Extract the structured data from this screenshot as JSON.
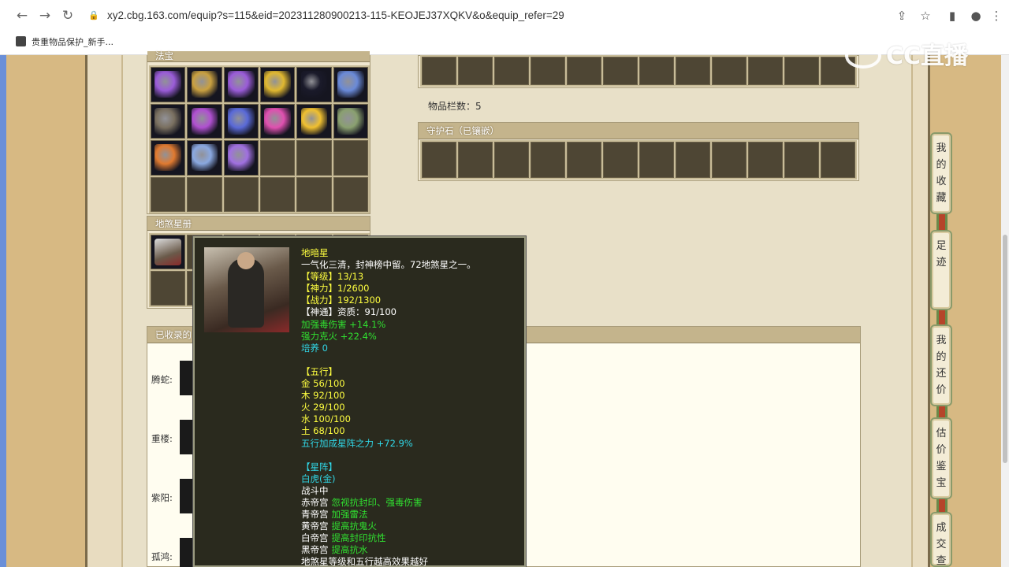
{
  "browser": {
    "url": "xy2.cbg.163.com/equip?s=115&eid=202311280900213-115-KEOJEJ37XQKV&o&equip_refer=29",
    "bookmark": "贵重物品保护_新手..."
  },
  "watermark": "CC直播",
  "fabao": {
    "title": "法宝",
    "items": [
      "purple-box",
      "gold-token",
      "violet-wand",
      "gold-pagoda",
      "dark-orb",
      "blue-glove",
      "grey-tablet",
      "purple-ribbon",
      "blue-scroll",
      "pink-lantern",
      "gold-cloud",
      "green-bell",
      "orange-shard",
      "blue-bracer",
      "purple-hammer"
    ]
  },
  "star_register": {
    "title": "地煞星册"
  },
  "slots": {
    "count_label": "物品栏数：5"
  },
  "guard_stone": {
    "title": "守护石（已镶嵌）"
  },
  "collected": {
    "title": "已收录的",
    "rows": [
      "腾蛇:",
      "重楼:",
      "紫阳:",
      "孤鸿:"
    ]
  },
  "sidebar": {
    "tabs": [
      "我的收藏",
      "足迹",
      "我的还价",
      "估价鉴宝",
      "成交查"
    ]
  },
  "tooltip": {
    "lines": [
      {
        "color": "yellow",
        "text": "地暗星"
      },
      {
        "color": "white",
        "text": "一气化三清，封神榜中留。72地煞星之一。"
      },
      {
        "color": "yellow",
        "text": "【等级】13/13"
      },
      {
        "color": "yellow",
        "text": "【神力】1/2600"
      },
      {
        "color": "yellow",
        "text": "【战力】192/1300"
      },
      {
        "color": "white",
        "text": "【神通】资质：91/100"
      },
      {
        "color": "green",
        "text": "加强毒伤害 +14.1%"
      },
      {
        "color": "green",
        "text": "强力克火 +22.4%"
      },
      {
        "color": "cyan",
        "text": "培养 0"
      },
      {
        "color": "white",
        "text": ""
      },
      {
        "color": "yellow",
        "text": "【五行】"
      },
      {
        "color": "yellow",
        "text": "金 56/100"
      },
      {
        "color": "yellow",
        "text": "木 92/100"
      },
      {
        "color": "yellow",
        "text": "火 29/100"
      },
      {
        "color": "yellow",
        "text": "水 100/100"
      },
      {
        "color": "yellow",
        "text": "土 68/100"
      },
      {
        "color": "cyan",
        "text": "五行加成星阵之力 +72.9%"
      },
      {
        "color": "white",
        "text": ""
      },
      {
        "color": "cyan",
        "text": "【星阵】"
      },
      {
        "color": "cyan",
        "text": "白虎(金)"
      },
      {
        "color": "white",
        "text": "战斗中"
      }
    ],
    "palaces": [
      {
        "name": "赤帝宫",
        "effect": "忽视抗封印、强毒伤害"
      },
      {
        "name": "青帝宫",
        "effect": "加强雷法"
      },
      {
        "name": "黄帝宫",
        "effect": "提高抗鬼火"
      },
      {
        "name": "白帝宫",
        "effect": "提高封印抗性"
      },
      {
        "name": "黑帝宫",
        "effect": "提高抗水"
      }
    ],
    "footer": "地煞星等级和五行越高效果越好"
  },
  "colors": {
    "yellow": "#ffff40",
    "green": "#30e030",
    "cyan": "#30d8e8",
    "white": "#ffffff",
    "fabao_items": [
      "#9a5cd8",
      "#c9a040",
      "#9a5cd8",
      "#e0b830",
      "#1a1a2a",
      "#6a8ad8",
      "#7a7060",
      "#b050d0",
      "#5a6ad8",
      "#e050b0",
      "#f0c030",
      "#8aa070",
      "#e07a30",
      "#8aa8e0",
      "#a070e0"
    ]
  }
}
